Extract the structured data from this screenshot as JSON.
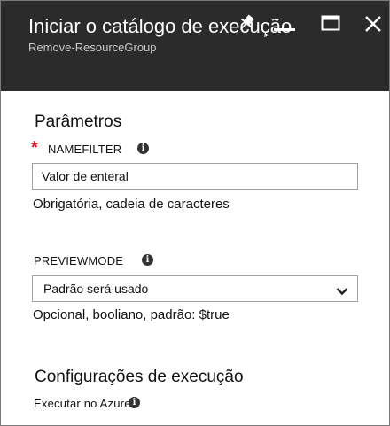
{
  "header": {
    "title": "Iniciar o catálogo de execução",
    "subtitle": "Remove-ResourceGroup"
  },
  "icons": {
    "pin": "pin-icon",
    "minimize": "minimize-icon",
    "maximize": "maximize-icon",
    "close": "close-icon",
    "info": "info-icon",
    "dropdown": "chevron-down-icon"
  },
  "parameters": {
    "section_title": "Parâmetros",
    "required_marker": "*",
    "namefilter": {
      "label": "NAMEFILTER",
      "value": "Valor de enteral",
      "help": "Obrigatória, cadeia de caracteres"
    },
    "previewmode": {
      "label": "PREVIEWMODE",
      "selected": "Padrão será usado",
      "help": "Opcional, booliano, padrão: $true"
    }
  },
  "run_settings": {
    "section_title": "Configurações de execução",
    "run_on_label": "Executar no Azure"
  },
  "info_glyph": "i",
  "colors": {
    "header_bg": "#2b2b2b",
    "required": "#e81123"
  }
}
